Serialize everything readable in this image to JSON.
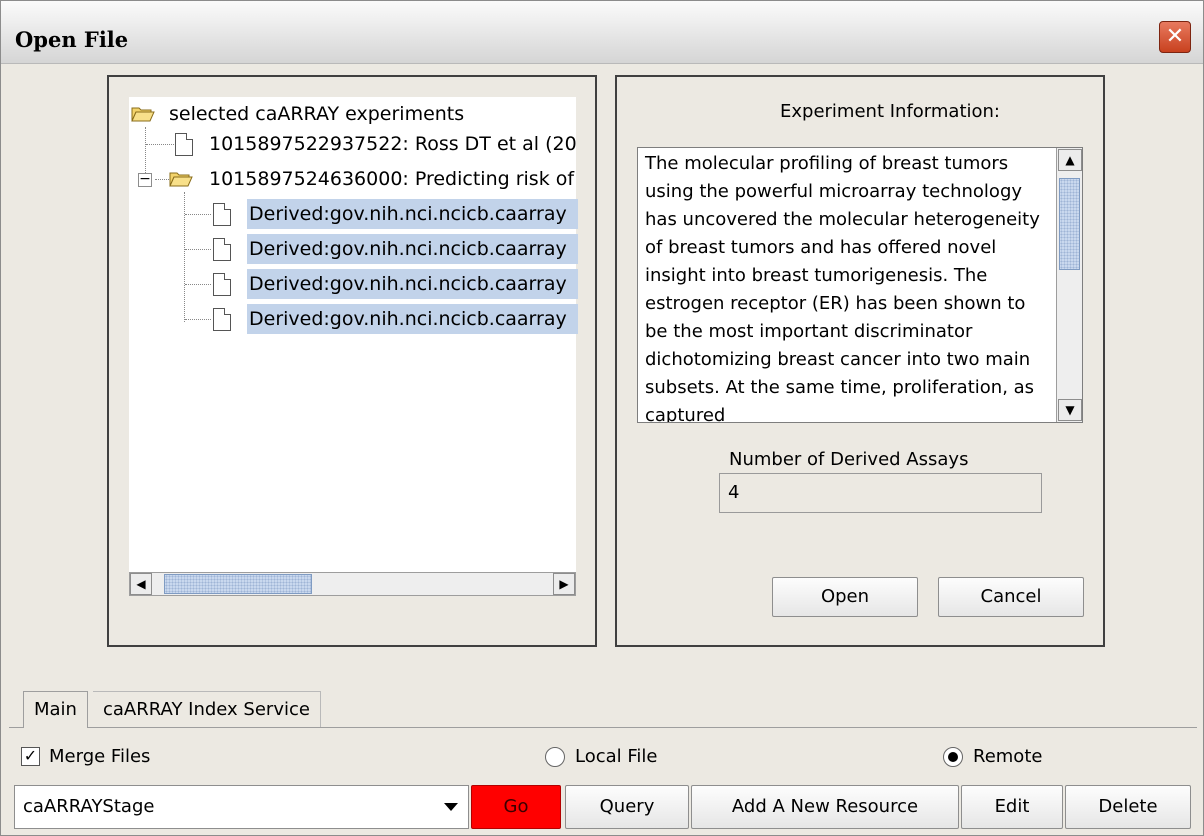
{
  "window": {
    "title": "Open File",
    "close_label": "✕"
  },
  "tree": {
    "root_label": "selected caARRAY experiments",
    "items": [
      {
        "label": "1015897522937522: Ross DT et al (20",
        "type": "file",
        "selected": false
      },
      {
        "label": "1015897524636000: Predicting risk of",
        "type": "folder",
        "selected": false
      },
      {
        "label": "Derived:gov.nih.nci.ncicb.caarray",
        "type": "file",
        "selected": true
      },
      {
        "label": "Derived:gov.nih.nci.ncicb.caarray",
        "type": "file",
        "selected": true
      },
      {
        "label": "Derived:gov.nih.nci.ncicb.caarray",
        "type": "file",
        "selected": true
      },
      {
        "label": "Derived:gov.nih.nci.ncicb.caarray",
        "type": "file",
        "selected": true
      }
    ],
    "collapse_toggle": "−"
  },
  "info": {
    "label": "Experiment Information:",
    "text": "The molecular profiling of breast tumors using the powerful microarray technology has uncovered the molecular heterogeneity of breast tumors and has offered novel insight into breast tumorigenesis. The estrogen receptor (ER) has been shown to be the most important discriminator dichotomizing breast cancer into two main subsets. At the same time, proliferation, as captured",
    "derived_label": "Number of Derived Assays",
    "derived_value": "4"
  },
  "buttons": {
    "open": "Open",
    "cancel": "Cancel"
  },
  "tabs": [
    {
      "label": "Main",
      "active": true
    },
    {
      "label": "caARRAY Index Service",
      "active": false
    }
  ],
  "options": {
    "merge_label": "Merge Files",
    "merge_checked": true,
    "local_label": "Local File",
    "remote_label": "Remote",
    "selected": "Remote"
  },
  "toolbar": {
    "resource": "caARRAYStage",
    "go": "Go",
    "query": "Query",
    "add": "Add A New Resource",
    "edit": "Edit",
    "delete": "Delete"
  },
  "colors": {
    "go_button": "#ff0000",
    "selection": "#c2d3ea"
  }
}
